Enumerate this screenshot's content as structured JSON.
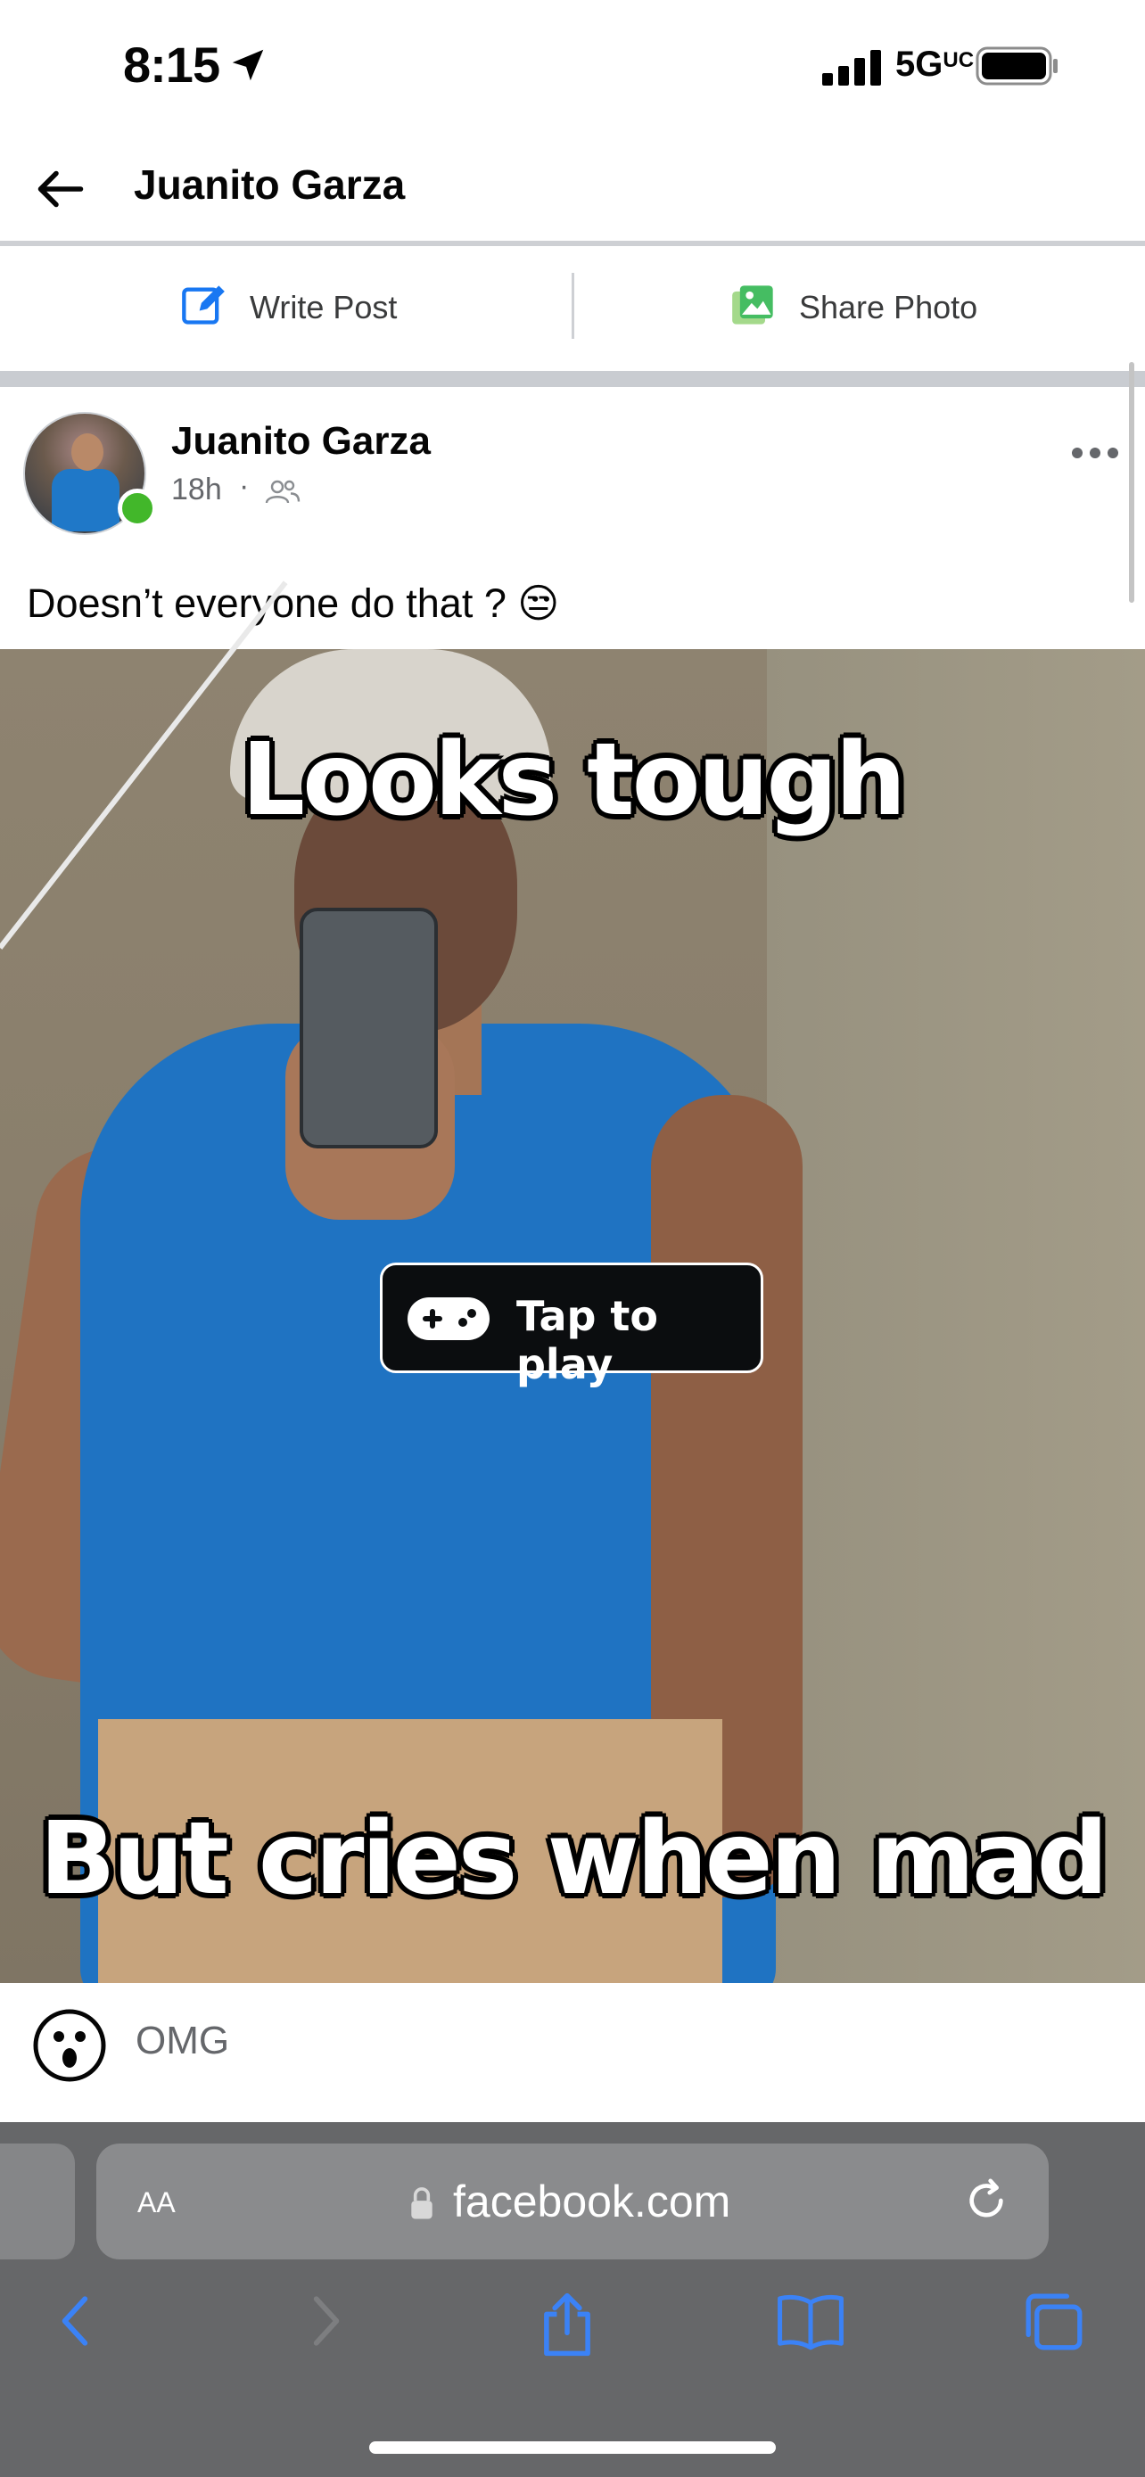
{
  "status_bar": {
    "time": "8:15",
    "network": "5G",
    "network_suffix": "UC"
  },
  "header": {
    "title": "Juanito Garza"
  },
  "actions": {
    "write_post": "Write Post",
    "share_photo": "Share Photo"
  },
  "post": {
    "author": "Juanito Garza",
    "time": "18h",
    "separator": "·",
    "text": "Doesn’t everyone do that ? 😒",
    "media": {
      "caption_top": "Looks tough",
      "caption_bottom": "But cries when mad",
      "play_label": "Tap to play"
    },
    "reaction": {
      "label": "OMG"
    }
  },
  "browser": {
    "aa_label": "AA",
    "url": "facebook.com"
  },
  "colors": {
    "brand_blue": "#1877f2",
    "safari_blue": "#3b82f6",
    "online_green": "#42b72a",
    "photo_green": "#45bd62"
  },
  "icons": [
    "back-arrow-icon",
    "edit-icon",
    "photo-icon",
    "friends-icon",
    "more-icon",
    "gamepad-icon",
    "omg-face-icon",
    "lock-icon",
    "reload-icon",
    "chevron-left-icon",
    "chevron-right-icon",
    "share-icon",
    "bookmarks-icon",
    "tabs-icon"
  ]
}
